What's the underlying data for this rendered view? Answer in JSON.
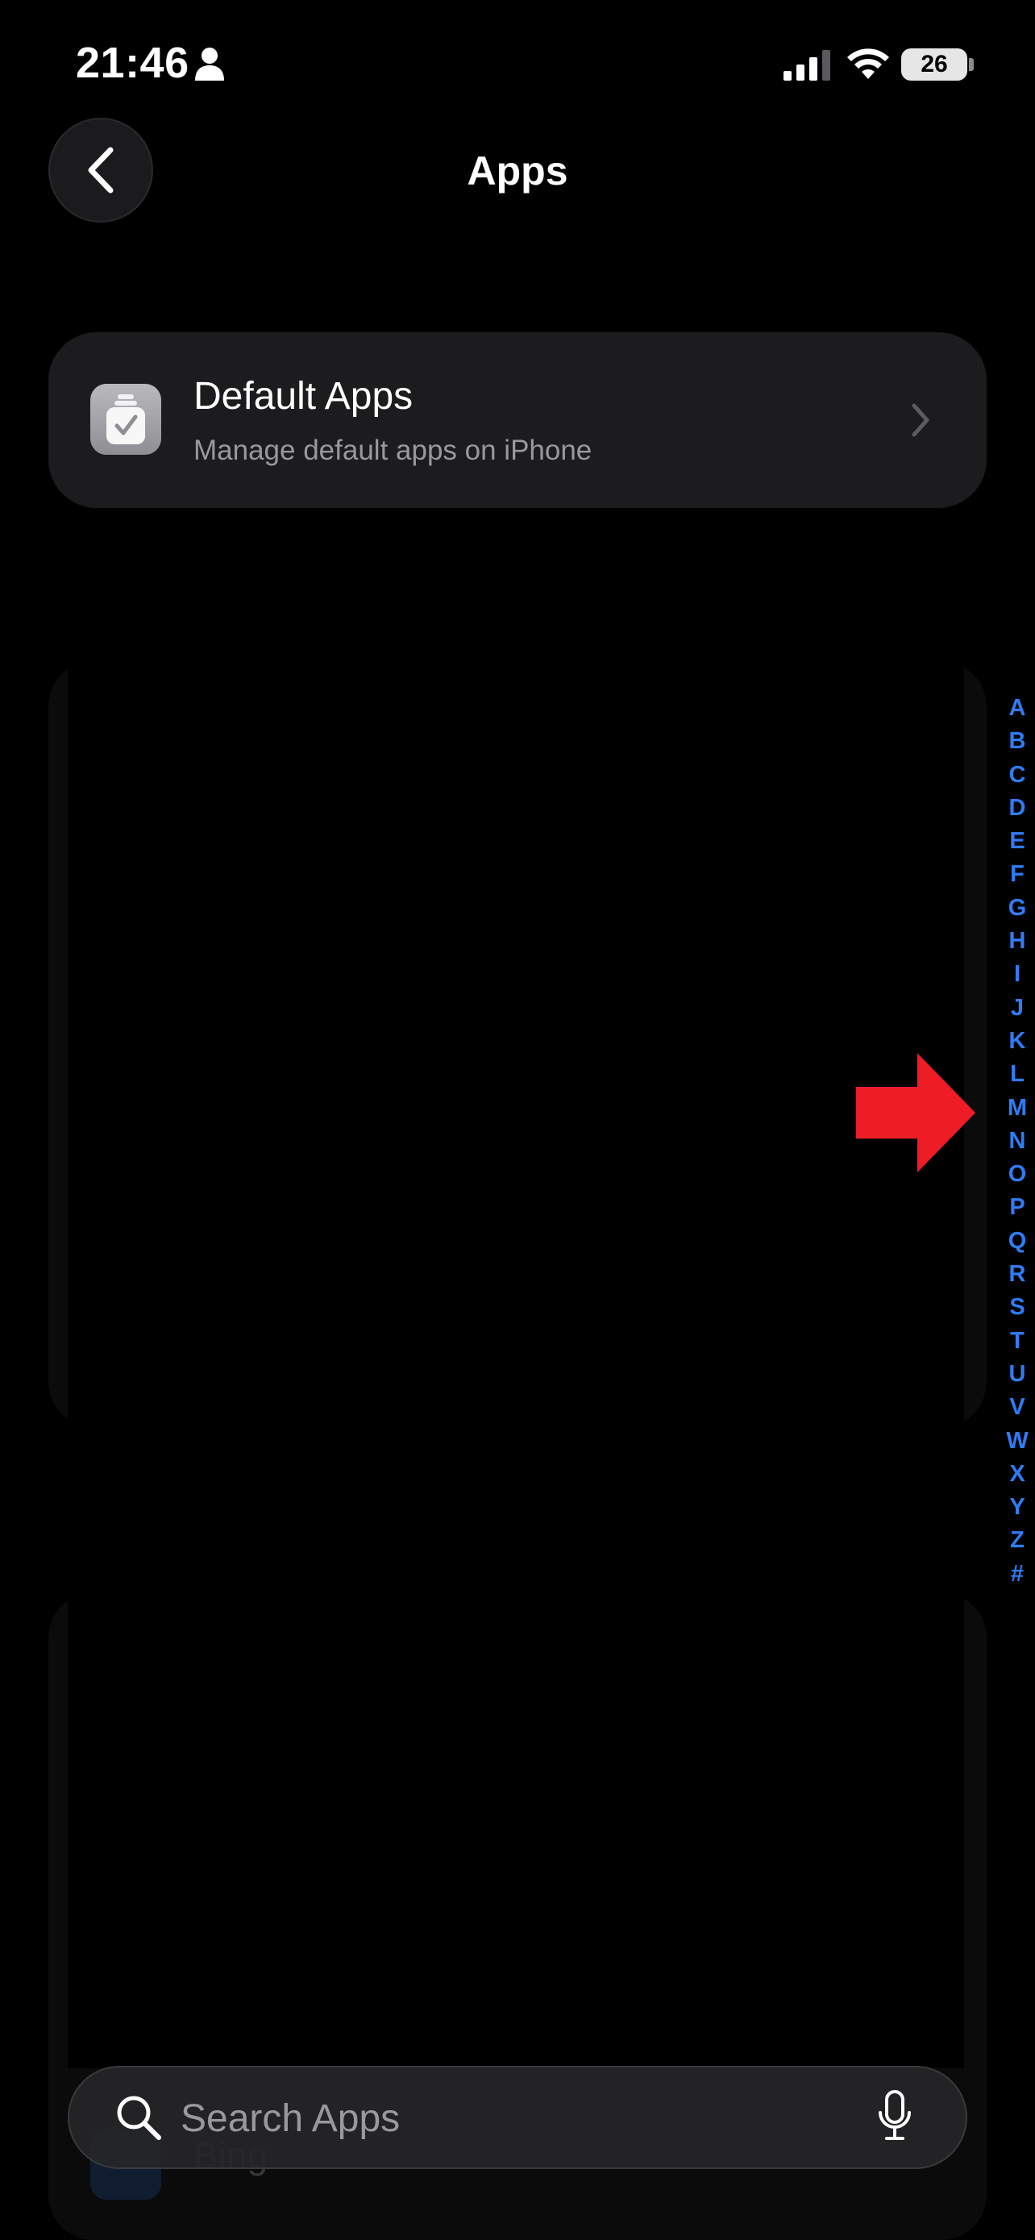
{
  "status_bar": {
    "time": "21:46",
    "battery_level": "26"
  },
  "nav": {
    "title": "Apps",
    "back_icon": "chevron-left-icon"
  },
  "default_apps": {
    "title": "Default Apps",
    "subtitle": "Manage default apps on iPhone",
    "icon": "default-apps-icon"
  },
  "peek_row": {
    "label": "Bing"
  },
  "alphabet_index": [
    "A",
    "B",
    "C",
    "D",
    "E",
    "F",
    "G",
    "H",
    "I",
    "J",
    "K",
    "L",
    "M",
    "N",
    "O",
    "P",
    "Q",
    "R",
    "S",
    "T",
    "U",
    "V",
    "W",
    "X",
    "Y",
    "Z",
    "#"
  ],
  "search": {
    "placeholder": "Search Apps",
    "value": ""
  },
  "colors": {
    "background": "#000000",
    "card": "#1c1c1e",
    "index_accent": "#2f7cf6",
    "annotation_arrow": "#ee1c25",
    "secondary_text": "#98989e"
  }
}
